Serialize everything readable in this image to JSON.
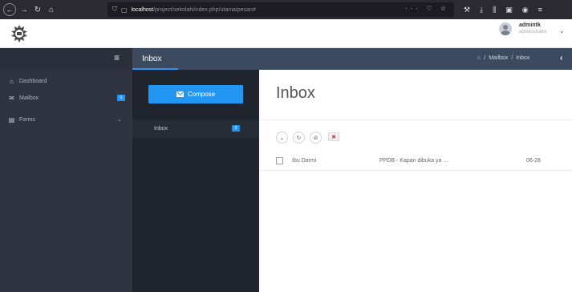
{
  "browser": {
    "url_host": "localhost",
    "url_path": "/project/sekolah/index.php/utama/pesan#",
    "url_actions": "··· ♡ ☆"
  },
  "header": {
    "user_name": "admintk",
    "user_role": "administrator"
  },
  "sidebar": {
    "items": [
      {
        "label": "Dashboard",
        "icon": "home-icon"
      },
      {
        "label": "Mailbox",
        "icon": "envelope-icon",
        "badge": "0"
      },
      {
        "label": "Forms",
        "icon": "form-icon"
      }
    ]
  },
  "titlebar": {
    "title": "Inbox",
    "crumbs": [
      "Mailbox",
      "/",
      "Inbox"
    ]
  },
  "mail_nav": {
    "compose_label": "Compose",
    "folders": [
      {
        "label": "Inbox",
        "badge": "0"
      }
    ]
  },
  "main": {
    "title": "Inbox",
    "messages": [
      {
        "from": "Ibu Darmi",
        "subject": "PPDB  -  Kapan dibuka ya ...",
        "date": "06-28"
      }
    ]
  },
  "colors": {
    "accent": "#2196f3",
    "sidebar": "#2f3440",
    "titlebar": "#3b4a5e",
    "delete": "#e53935"
  }
}
